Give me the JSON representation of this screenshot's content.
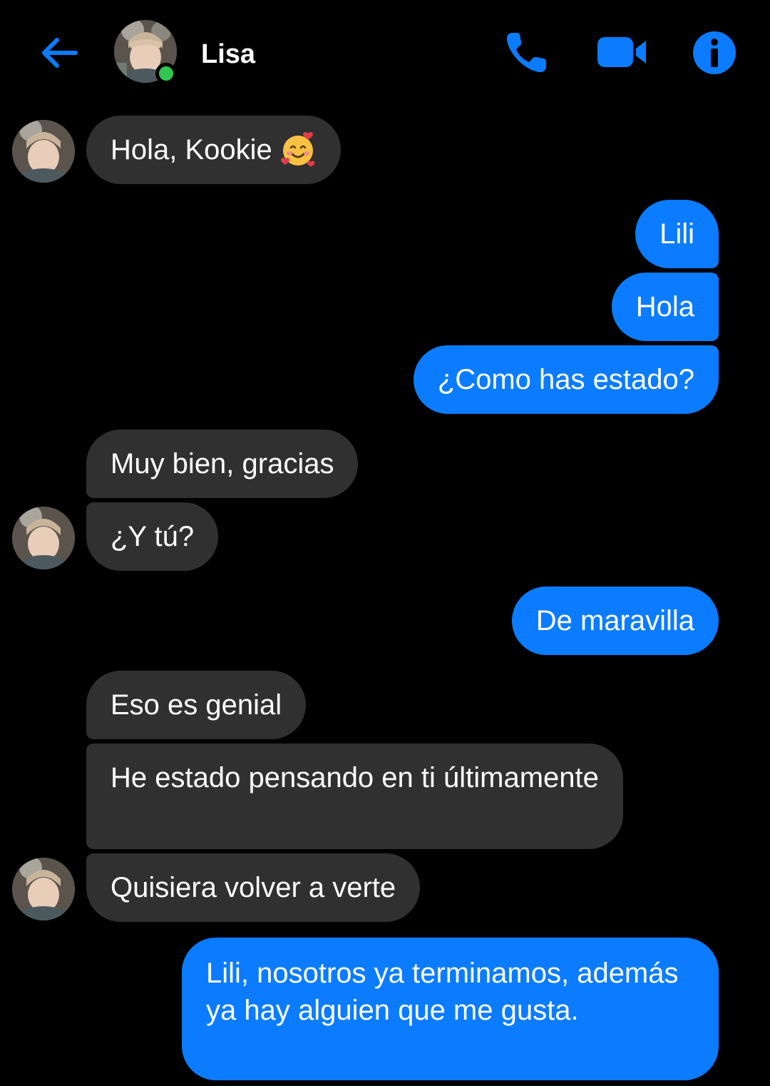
{
  "header": {
    "contact_name": "Lisa",
    "online": true,
    "icons": {
      "back": "arrow-left-icon",
      "call": "phone-icon",
      "video": "video-camera-icon",
      "info": "info-icon"
    },
    "colors": {
      "accent": "#0b7cff",
      "online": "#31c552"
    }
  },
  "messages": [
    {
      "sender": "Lisa",
      "text": "Hola, Kookie",
      "emoji": "smiling-face-with-hearts"
    },
    {
      "sender": "me",
      "text": "Lili"
    },
    {
      "sender": "me",
      "text": "Hola"
    },
    {
      "sender": "me",
      "text": "¿Como has estado?"
    },
    {
      "sender": "Lisa",
      "text": "Muy bien, gracias"
    },
    {
      "sender": "Lisa",
      "text": "¿Y tú?"
    },
    {
      "sender": "me",
      "text": "De maravilla"
    },
    {
      "sender": "Lisa",
      "text": "Eso es genial"
    },
    {
      "sender": "Lisa",
      "text": "He estado pensando en ti últimamente"
    },
    {
      "sender": "Lisa",
      "text": "Quisiera volver a verte"
    },
    {
      "sender": "me",
      "text": "Lili, nosotros ya terminamos, además ya hay alguien que me gusta."
    }
  ],
  "colors": {
    "incoming_bubble": "#303030",
    "outgoing_bubble": "#0b7cff",
    "background": "#000000"
  }
}
